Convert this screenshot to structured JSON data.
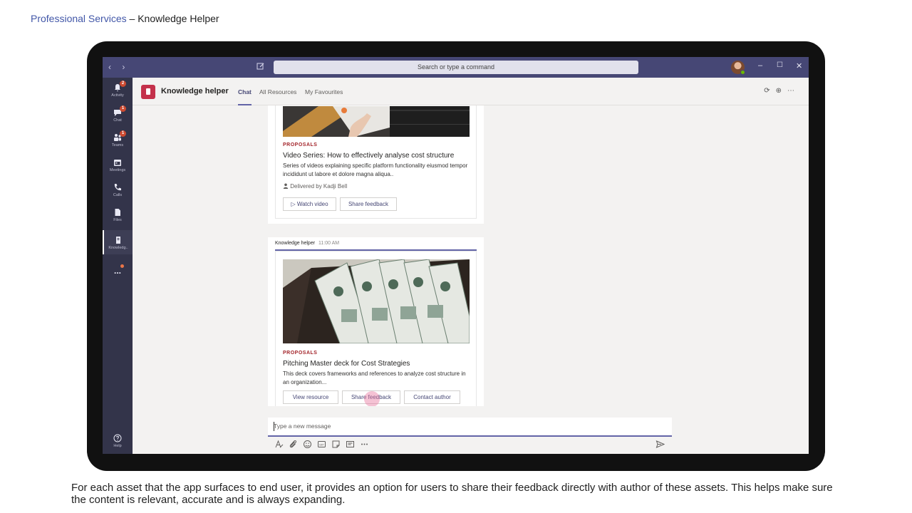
{
  "slide": {
    "title_accent": "Professional Services",
    "title_rest": " – Knowledge  Helper",
    "caption": "For each asset that the app surfaces to end user, it provides an option for users to share their feedback directly with author of these assets. This helps make sure the content is relevant, accurate and is always expanding."
  },
  "titlebar": {
    "search_placeholder": "Search or type a command"
  },
  "rail": {
    "items": [
      {
        "label": "Activity",
        "badge": "2",
        "icon": "bell-icon"
      },
      {
        "label": "Chat",
        "badge": "1",
        "icon": "chat-icon"
      },
      {
        "label": "Teams",
        "badge": "1",
        "icon": "teams-icon"
      },
      {
        "label": "Meetings",
        "badge": "",
        "icon": "calendar-icon"
      },
      {
        "label": "Calls",
        "badge": "",
        "icon": "phone-icon"
      },
      {
        "label": "Files",
        "badge": "",
        "icon": "file-icon"
      },
      {
        "label": "Knowledg..",
        "badge": "",
        "icon": "knowledge-icon"
      },
      {
        "label": "...",
        "badge": "",
        "icon": "more-icon"
      }
    ],
    "help_label": "Help"
  },
  "app": {
    "name": "Knowledge helper",
    "tabs": [
      "Chat",
      "All Resources",
      "My Favourites"
    ],
    "active_tab": "Chat"
  },
  "cards": [
    {
      "category": "PROPOSALS",
      "title": "Video Series: How to effectively analyse cost structure",
      "description": "Series of videos explaining specific platform functionality eiusmod tempor incididunt ut labore et dolore magna aliqua..",
      "meta": "Delivered by Kadji Bell",
      "buttons": [
        "Watch video",
        "Share feedback"
      ]
    },
    {
      "sender": "Knowledge helper",
      "time": "11:00 AM",
      "category": "PROPOSALS",
      "title": "Pitching Master deck for Cost Strategies",
      "description": "This deck covers frameworks and references to analyze cost structure in an organization...",
      "buttons": [
        "View resource",
        "Share feedback",
        "Contact author"
      ]
    }
  ],
  "composer": {
    "placeholder": "Type a new message"
  },
  "colors": {
    "teams_purple": "#464775",
    "accent": "#6264a7",
    "category_red": "#a4262c",
    "badge_red": "#cc4a31"
  }
}
